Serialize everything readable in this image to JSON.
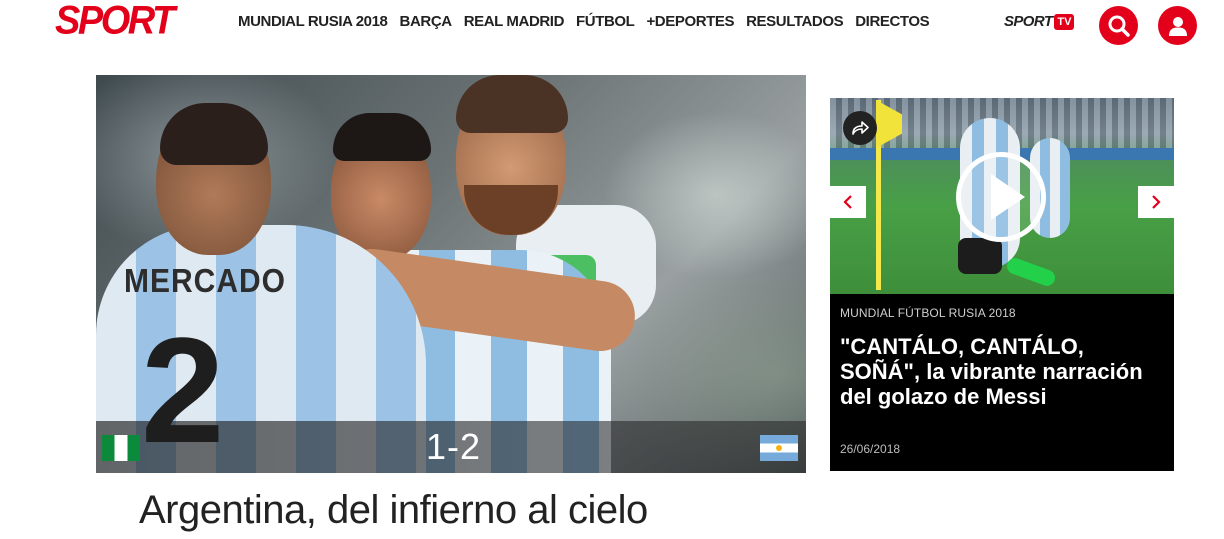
{
  "header": {
    "logo": "SPORT",
    "nav": [
      "MUNDIAL RUSIA 2018",
      "BARÇA",
      "REAL MADRID",
      "FÚTBOL",
      "+DEPORTES",
      "RESULTADOS",
      "DIRECTOS"
    ],
    "sporttv": {
      "word": "SPORT",
      "badge": "TV"
    },
    "icons": {
      "search": "search-icon",
      "user": "user-icon"
    }
  },
  "hero": {
    "jersey_name": "MERCADO",
    "jersey_number": "2",
    "score": "1-2",
    "home_flag": "nigeria-flag",
    "away_flag": "argentina-flag",
    "headline": "Argentina, del infierno al cielo"
  },
  "card": {
    "kicker": "MUNDIAL FÚTBOL RUSIA 2018",
    "title": "\"CANTÁLO, CANTÁLO, SOÑÁ\", la vibrante narración del golazo de Messi",
    "date": "26/06/2018",
    "icons": {
      "share": "share-icon",
      "play": "play-icon",
      "prev": "chevron-left-icon",
      "next": "chevron-right-icon"
    }
  },
  "colors": {
    "brand_red": "#e3001b",
    "card_bg": "#000000"
  }
}
